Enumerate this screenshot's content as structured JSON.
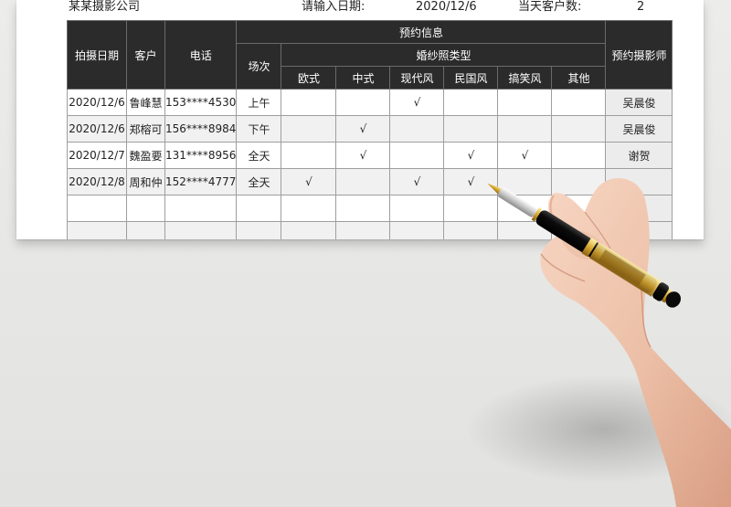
{
  "header": {
    "company": "某某摄影公司",
    "date_label": "请输入日期:",
    "date_value": "2020/12/6",
    "count_label": "当天客户数:",
    "count_value": "2"
  },
  "table": {
    "col_date": "拍摄日期",
    "col_customer": "客户",
    "col_phone": "电话",
    "col_booking": "预约信息",
    "col_session": "场次",
    "col_wedding_type": "婚纱照类型",
    "styles": [
      "欧式",
      "中式",
      "现代风",
      "民国风",
      "搞笑风",
      "其他"
    ],
    "col_photographer": "预约摄影师",
    "check_mark": "√",
    "rows": [
      {
        "date": "2020/12/6",
        "customer": "鲁峰慧",
        "phone": "153****4530",
        "session": "上午",
        "checks": [
          "",
          "",
          "√",
          "",
          "",
          ""
        ],
        "photographer": "吴晨俊"
      },
      {
        "date": "2020/12/6",
        "customer": "郑榕可",
        "phone": "156****8984",
        "session": "下午",
        "checks": [
          "",
          "√",
          "",
          "",
          "",
          ""
        ],
        "photographer": "吴晨俊"
      },
      {
        "date": "2020/12/7",
        "customer": "魏盈要",
        "phone": "131****8956",
        "session": "全天",
        "checks": [
          "",
          "√",
          "",
          "√",
          "√",
          ""
        ],
        "photographer": "谢贺"
      },
      {
        "date": "2020/12/8",
        "customer": "周和仲",
        "phone": "152****4777",
        "session": "全天",
        "checks": [
          "√",
          "",
          "√",
          "√",
          "",
          ""
        ],
        "photographer": ""
      },
      {
        "date": "",
        "customer": "",
        "phone": "",
        "session": "",
        "checks": [
          "",
          "",
          "",
          "",
          "",
          ""
        ],
        "photographer": ""
      },
      {
        "date": "",
        "customer": "",
        "phone": "",
        "session": "",
        "checks": [
          "",
          "",
          "",
          "",
          "",
          ""
        ],
        "photographer": ""
      }
    ]
  }
}
